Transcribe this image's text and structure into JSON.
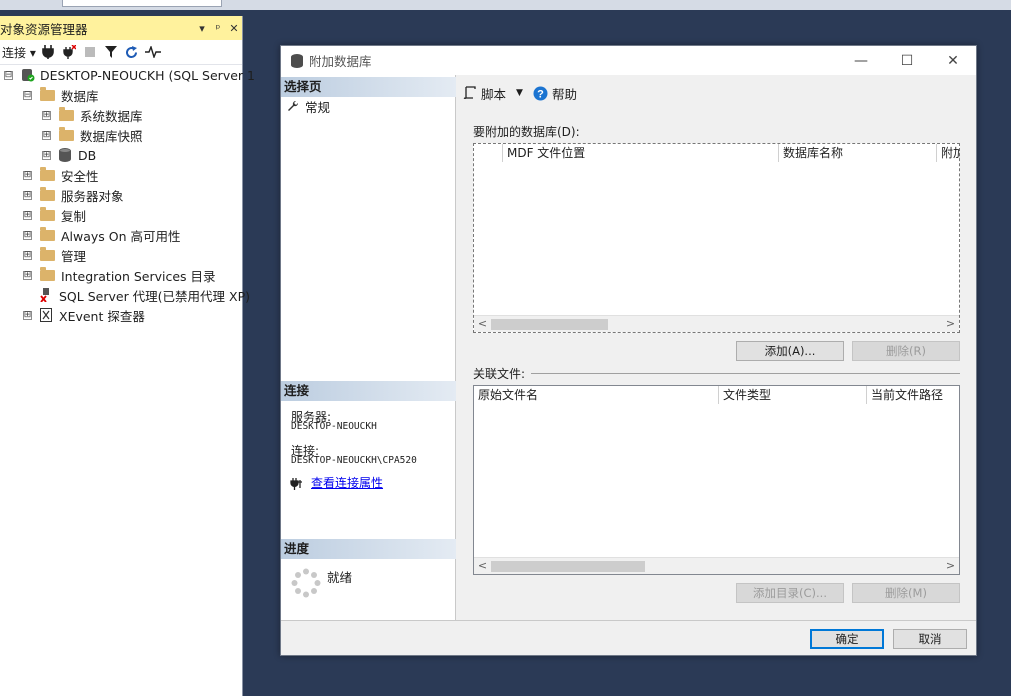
{
  "object_explorer": {
    "title": "对象资源管理器",
    "header_buttons": [
      "▾",
      "ᵖ",
      "✕"
    ],
    "toolbar": {
      "connect_label": "连接 ▾",
      "icons": [
        "connect-plug-icon",
        "disconnect-icon",
        "stop-icon",
        "filter-icon",
        "refresh-icon",
        "activity-monitor-icon"
      ]
    },
    "tree": [
      {
        "label": "DESKTOP-NEOUCKH (SQL Server 1",
        "expander": "⊟",
        "icon": "server-icon",
        "level": 0
      },
      {
        "label": "数据库",
        "expander": "⊟",
        "icon": "folder-icon",
        "level": 1
      },
      {
        "label": "系统数据库",
        "expander": "⊞",
        "icon": "folder-icon",
        "level": 2
      },
      {
        "label": "数据库快照",
        "expander": "⊞",
        "icon": "folder-icon",
        "level": 2
      },
      {
        "label": "DB",
        "expander": "⊞",
        "icon": "database-icon",
        "level": 2
      },
      {
        "label": "安全性",
        "expander": "⊞",
        "icon": "folder-icon",
        "level": 1
      },
      {
        "label": "服务器对象",
        "expander": "⊞",
        "icon": "folder-icon",
        "level": 1
      },
      {
        "label": "复制",
        "expander": "⊞",
        "icon": "folder-icon",
        "level": 1
      },
      {
        "label": "Always On 高可用性",
        "expander": "⊞",
        "icon": "folder-icon",
        "level": 1
      },
      {
        "label": "管理",
        "expander": "⊞",
        "icon": "folder-icon",
        "level": 1
      },
      {
        "label": "Integration Services 目录",
        "expander": "⊞",
        "icon": "folder-icon",
        "level": 1
      },
      {
        "label": "SQL Server 代理(已禁用代理 XP)",
        "expander": "",
        "icon": "sql-agent-disabled-icon",
        "level": 1
      },
      {
        "label": "XEvent 探查器",
        "expander": "⊞",
        "icon": "xevent-icon",
        "level": 1
      }
    ]
  },
  "dialog": {
    "title": "附加数据库",
    "window_buttons": [
      "—",
      "☐",
      "✕"
    ],
    "left": {
      "select_page_header": "选择页",
      "pages": [
        "常规"
      ],
      "connection_header": "连接",
      "server_label": "服务器:",
      "server_value": "DESKTOP-NEOUCKH",
      "connection_label": "连接:",
      "connection_value": "DESKTOP-NEOUCKH\\CPA520",
      "view_connection_link": "查看连接属性",
      "progress_header": "进度",
      "progress_status": "就绪"
    },
    "toolbar": {
      "script_label": "脚本",
      "help_label": "帮助"
    },
    "databases": {
      "label": "要附加的数据库(D):",
      "columns": [
        "MDF 文件位置",
        "数据库名称",
        "附加"
      ]
    },
    "add_button": "添加(A)...",
    "remove_button": "删除(R)",
    "related_files": {
      "label": "关联文件:",
      "columns": [
        "原始文件名",
        "文件类型",
        "当前文件路径"
      ]
    },
    "add_catalog_button": "添加目录(C)...",
    "remove_file_button": "删除(M)",
    "ok_button": "确定",
    "cancel_button": "取消"
  }
}
